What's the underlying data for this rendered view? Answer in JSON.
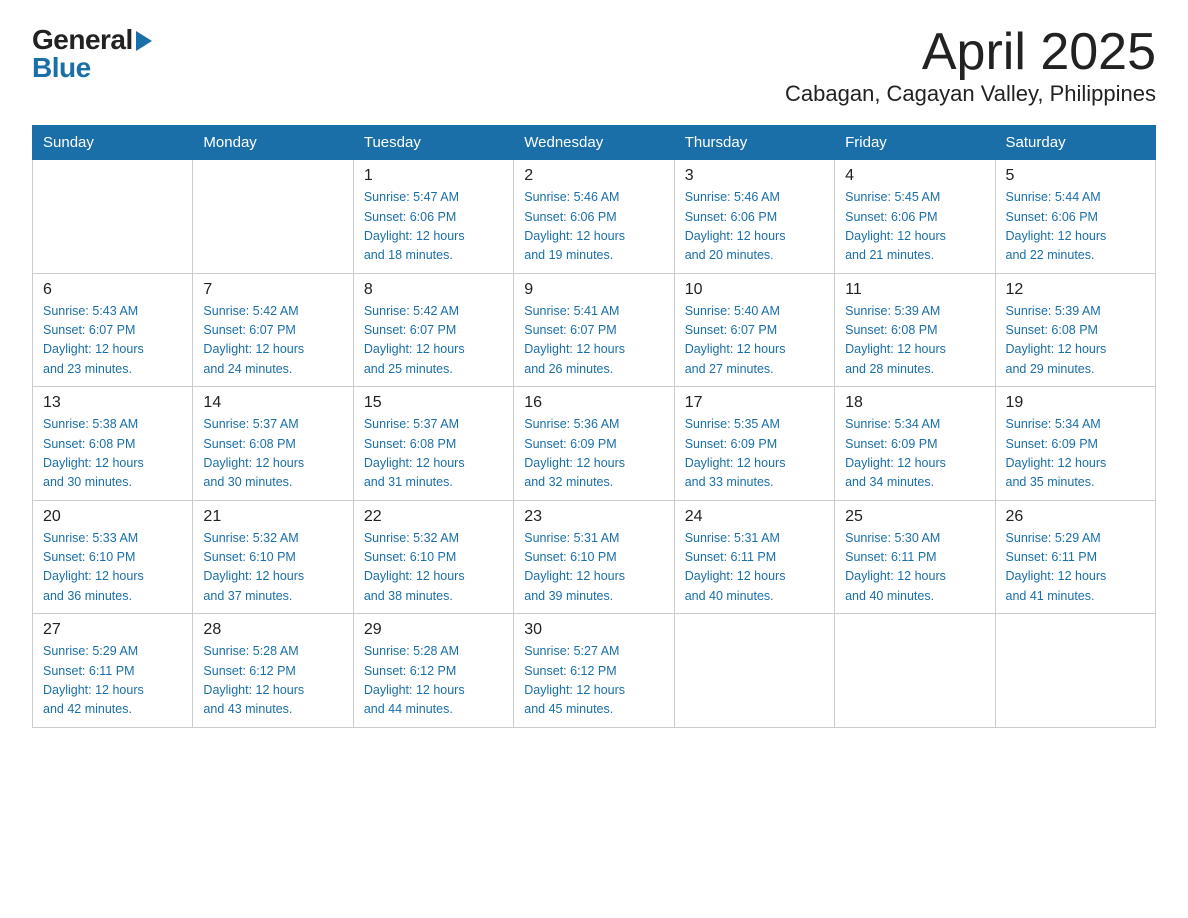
{
  "header": {
    "title": "April 2025",
    "subtitle": "Cabagan, Cagayan Valley, Philippines"
  },
  "logo": {
    "general": "General",
    "blue": "Blue"
  },
  "days": [
    "Sunday",
    "Monday",
    "Tuesday",
    "Wednesday",
    "Thursday",
    "Friday",
    "Saturday"
  ],
  "weeks": [
    [
      {
        "num": "",
        "info": ""
      },
      {
        "num": "",
        "info": ""
      },
      {
        "num": "1",
        "info": "Sunrise: 5:47 AM\nSunset: 6:06 PM\nDaylight: 12 hours\nand 18 minutes."
      },
      {
        "num": "2",
        "info": "Sunrise: 5:46 AM\nSunset: 6:06 PM\nDaylight: 12 hours\nand 19 minutes."
      },
      {
        "num": "3",
        "info": "Sunrise: 5:46 AM\nSunset: 6:06 PM\nDaylight: 12 hours\nand 20 minutes."
      },
      {
        "num": "4",
        "info": "Sunrise: 5:45 AM\nSunset: 6:06 PM\nDaylight: 12 hours\nand 21 minutes."
      },
      {
        "num": "5",
        "info": "Sunrise: 5:44 AM\nSunset: 6:06 PM\nDaylight: 12 hours\nand 22 minutes."
      }
    ],
    [
      {
        "num": "6",
        "info": "Sunrise: 5:43 AM\nSunset: 6:07 PM\nDaylight: 12 hours\nand 23 minutes."
      },
      {
        "num": "7",
        "info": "Sunrise: 5:42 AM\nSunset: 6:07 PM\nDaylight: 12 hours\nand 24 minutes."
      },
      {
        "num": "8",
        "info": "Sunrise: 5:42 AM\nSunset: 6:07 PM\nDaylight: 12 hours\nand 25 minutes."
      },
      {
        "num": "9",
        "info": "Sunrise: 5:41 AM\nSunset: 6:07 PM\nDaylight: 12 hours\nand 26 minutes."
      },
      {
        "num": "10",
        "info": "Sunrise: 5:40 AM\nSunset: 6:07 PM\nDaylight: 12 hours\nand 27 minutes."
      },
      {
        "num": "11",
        "info": "Sunrise: 5:39 AM\nSunset: 6:08 PM\nDaylight: 12 hours\nand 28 minutes."
      },
      {
        "num": "12",
        "info": "Sunrise: 5:39 AM\nSunset: 6:08 PM\nDaylight: 12 hours\nand 29 minutes."
      }
    ],
    [
      {
        "num": "13",
        "info": "Sunrise: 5:38 AM\nSunset: 6:08 PM\nDaylight: 12 hours\nand 30 minutes."
      },
      {
        "num": "14",
        "info": "Sunrise: 5:37 AM\nSunset: 6:08 PM\nDaylight: 12 hours\nand 30 minutes."
      },
      {
        "num": "15",
        "info": "Sunrise: 5:37 AM\nSunset: 6:08 PM\nDaylight: 12 hours\nand 31 minutes."
      },
      {
        "num": "16",
        "info": "Sunrise: 5:36 AM\nSunset: 6:09 PM\nDaylight: 12 hours\nand 32 minutes."
      },
      {
        "num": "17",
        "info": "Sunrise: 5:35 AM\nSunset: 6:09 PM\nDaylight: 12 hours\nand 33 minutes."
      },
      {
        "num": "18",
        "info": "Sunrise: 5:34 AM\nSunset: 6:09 PM\nDaylight: 12 hours\nand 34 minutes."
      },
      {
        "num": "19",
        "info": "Sunrise: 5:34 AM\nSunset: 6:09 PM\nDaylight: 12 hours\nand 35 minutes."
      }
    ],
    [
      {
        "num": "20",
        "info": "Sunrise: 5:33 AM\nSunset: 6:10 PM\nDaylight: 12 hours\nand 36 minutes."
      },
      {
        "num": "21",
        "info": "Sunrise: 5:32 AM\nSunset: 6:10 PM\nDaylight: 12 hours\nand 37 minutes."
      },
      {
        "num": "22",
        "info": "Sunrise: 5:32 AM\nSunset: 6:10 PM\nDaylight: 12 hours\nand 38 minutes."
      },
      {
        "num": "23",
        "info": "Sunrise: 5:31 AM\nSunset: 6:10 PM\nDaylight: 12 hours\nand 39 minutes."
      },
      {
        "num": "24",
        "info": "Sunrise: 5:31 AM\nSunset: 6:11 PM\nDaylight: 12 hours\nand 40 minutes."
      },
      {
        "num": "25",
        "info": "Sunrise: 5:30 AM\nSunset: 6:11 PM\nDaylight: 12 hours\nand 40 minutes."
      },
      {
        "num": "26",
        "info": "Sunrise: 5:29 AM\nSunset: 6:11 PM\nDaylight: 12 hours\nand 41 minutes."
      }
    ],
    [
      {
        "num": "27",
        "info": "Sunrise: 5:29 AM\nSunset: 6:11 PM\nDaylight: 12 hours\nand 42 minutes."
      },
      {
        "num": "28",
        "info": "Sunrise: 5:28 AM\nSunset: 6:12 PM\nDaylight: 12 hours\nand 43 minutes."
      },
      {
        "num": "29",
        "info": "Sunrise: 5:28 AM\nSunset: 6:12 PM\nDaylight: 12 hours\nand 44 minutes."
      },
      {
        "num": "30",
        "info": "Sunrise: 5:27 AM\nSunset: 6:12 PM\nDaylight: 12 hours\nand 45 minutes."
      },
      {
        "num": "",
        "info": ""
      },
      {
        "num": "",
        "info": ""
      },
      {
        "num": "",
        "info": ""
      }
    ]
  ]
}
